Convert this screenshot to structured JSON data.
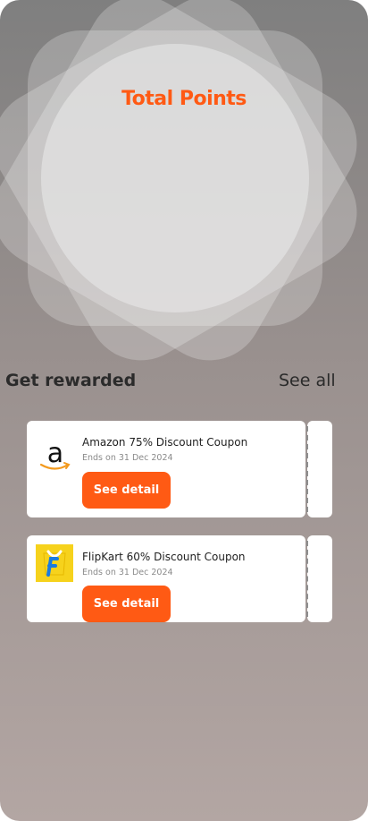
{
  "header": {
    "title": "Total Points"
  },
  "rewards": {
    "section_title": "Get rewarded",
    "see_all_label": "See all",
    "coupons": [
      {
        "title": "Amazon 75% Discount Coupon",
        "date": "Ends on 31 Dec 2024",
        "button_label": "See detail",
        "logo_icon": "amazon-logo"
      },
      {
        "title": "FlipKart 60% Discount Coupon",
        "date": "Ends on 31 Dec 2024",
        "button_label": "See detail",
        "logo_icon": "flipkart-logo"
      }
    ]
  },
  "colors": {
    "accent": "#ff5a14",
    "card": "#ffffff",
    "text": "#2b2b2b"
  }
}
